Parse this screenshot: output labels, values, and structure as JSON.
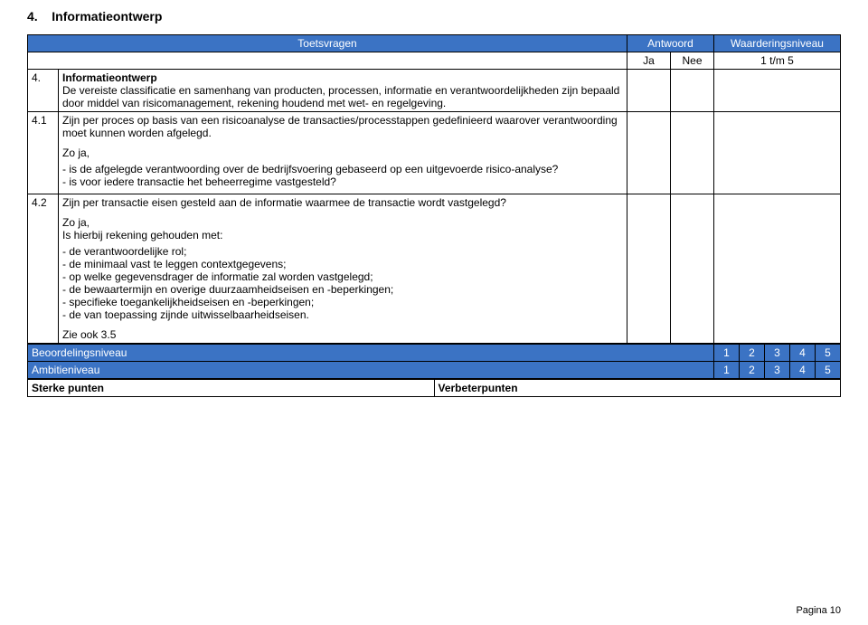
{
  "section": {
    "number": "4.",
    "title": "Informatieontwerp"
  },
  "header": {
    "toetsvragen": "Toetsvragen",
    "antwoord": "Antwoord",
    "waarderingsniveau": "Waarderingsniveau",
    "ja": "Ja",
    "nee": "Nee",
    "scale": "1 t/m 5"
  },
  "rows": {
    "r4": {
      "num": "4.",
      "title": "Informatieontwerp",
      "desc": "De vereiste classificatie en samenhang van producten, processen, informatie en verantwoordelijkheden zijn bepaald door middel van risicomanagement, rekening houdend met wet- en regelgeving."
    },
    "r41": {
      "num": "4.1",
      "text": "Zijn per proces op basis van een risicoanalyse de transacties/processtappen gedefinieerd waarover verantwoording moet kunnen worden afgelegd.",
      "zoja_label": "Zo ja,",
      "bullets": {
        "b1": "is de afgelegde verantwoording over de bedrijfsvoering gebaseerd op een uitgevoerde risico-analyse?",
        "b2": "is voor iedere transactie het beheerregime vastgesteld?"
      }
    },
    "r42": {
      "num": "4.2",
      "text": "Zijn per transactie eisen gesteld aan de informatie waarmee de transactie wordt vastgelegd?",
      "zoja_label": "Zo ja,",
      "intro": "Is hierbij rekening gehouden met:",
      "bullets": {
        "b1": "de verantwoordelijke rol;",
        "b2": "de minimaal vast te leggen contextgegevens;",
        "b3": "op welke gegevensdrager de informatie zal worden vastgelegd;",
        "b4": "de bewaartermijn en overige duurzaamheidseisen en -beperkingen;",
        "b5": "specifieke toegankelijkheidseisen en -beperkingen;",
        "b6": "de van toepassing zijnde uitwisselbaarheidseisen."
      },
      "zieook": "Zie ook 3.5"
    }
  },
  "levels": {
    "beoordeling_label": "Beoordelingsniveau",
    "ambitie_label": "Ambitieniveau",
    "n1": "1",
    "n2": "2",
    "n3": "3",
    "n4": "4",
    "n5": "5"
  },
  "bottom": {
    "sterke": "Sterke punten",
    "verbeter": "Verbeterpunten"
  },
  "footer": {
    "page": "Pagina 10"
  }
}
